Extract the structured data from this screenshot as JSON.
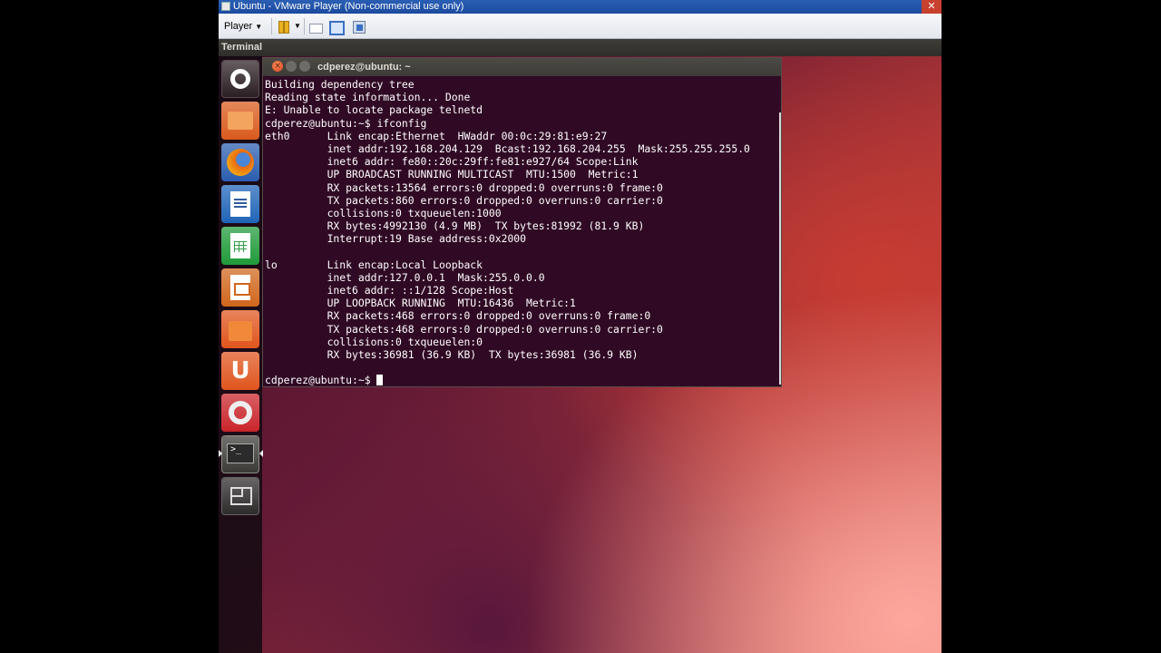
{
  "vm": {
    "title": "Ubuntu - VMware Player (Non-commercial use only)",
    "close_glyph": "✕",
    "player_menu": "Player",
    "menu_caret": "▼"
  },
  "panel": {
    "title": "Terminal"
  },
  "launcher": {
    "items": [
      {
        "name": "dash-home",
        "icon": "ubuntu-logo-icon"
      },
      {
        "name": "home-folder",
        "icon": "folder-icon"
      },
      {
        "name": "firefox",
        "icon": "firefox-icon"
      },
      {
        "name": "libreoffice-writer",
        "icon": "writer-document-icon"
      },
      {
        "name": "libreoffice-calc",
        "icon": "calc-spreadsheet-icon"
      },
      {
        "name": "libreoffice-impress",
        "icon": "impress-presentation-icon"
      },
      {
        "name": "ubuntu-software-center",
        "icon": "shopping-bag-icon"
      },
      {
        "name": "ubuntu-one",
        "icon": "ubuntu-one-icon",
        "glyph": "U"
      },
      {
        "name": "system-settings",
        "icon": "settings-wrench-icon"
      },
      {
        "name": "terminal",
        "icon": "terminal-icon",
        "glyph": ">_"
      },
      {
        "name": "workspace-switcher",
        "icon": "workspaces-icon"
      }
    ]
  },
  "terminal": {
    "title": "cdperez@ubuntu: ~",
    "close_glyph": "×",
    "lines": [
      "Building dependency tree",
      "Reading state information... Done",
      "E: Unable to locate package telnetd",
      "cdperez@ubuntu:~$ ifconfig",
      "eth0      Link encap:Ethernet  HWaddr 00:0c:29:81:e9:27",
      "          inet addr:192.168.204.129  Bcast:192.168.204.255  Mask:255.255.255.0",
      "          inet6 addr: fe80::20c:29ff:fe81:e927/64 Scope:Link",
      "          UP BROADCAST RUNNING MULTICAST  MTU:1500  Metric:1",
      "          RX packets:13564 errors:0 dropped:0 overruns:0 frame:0",
      "          TX packets:860 errors:0 dropped:0 overruns:0 carrier:0",
      "          collisions:0 txqueuelen:1000",
      "          RX bytes:4992130 (4.9 MB)  TX bytes:81992 (81.9 KB)",
      "          Interrupt:19 Base address:0x2000",
      "",
      "lo        Link encap:Local Loopback",
      "          inet addr:127.0.0.1  Mask:255.0.0.0",
      "          inet6 addr: ::1/128 Scope:Host",
      "          UP LOOPBACK RUNNING  MTU:16436  Metric:1",
      "          RX packets:468 errors:0 dropped:0 overruns:0 frame:0",
      "          TX packets:468 errors:0 dropped:0 overruns:0 carrier:0",
      "          collisions:0 txqueuelen:0",
      "          RX bytes:36981 (36.9 KB)  TX bytes:36981 (36.9 KB)",
      ""
    ],
    "prompt": "cdperez@ubuntu:~$ "
  }
}
